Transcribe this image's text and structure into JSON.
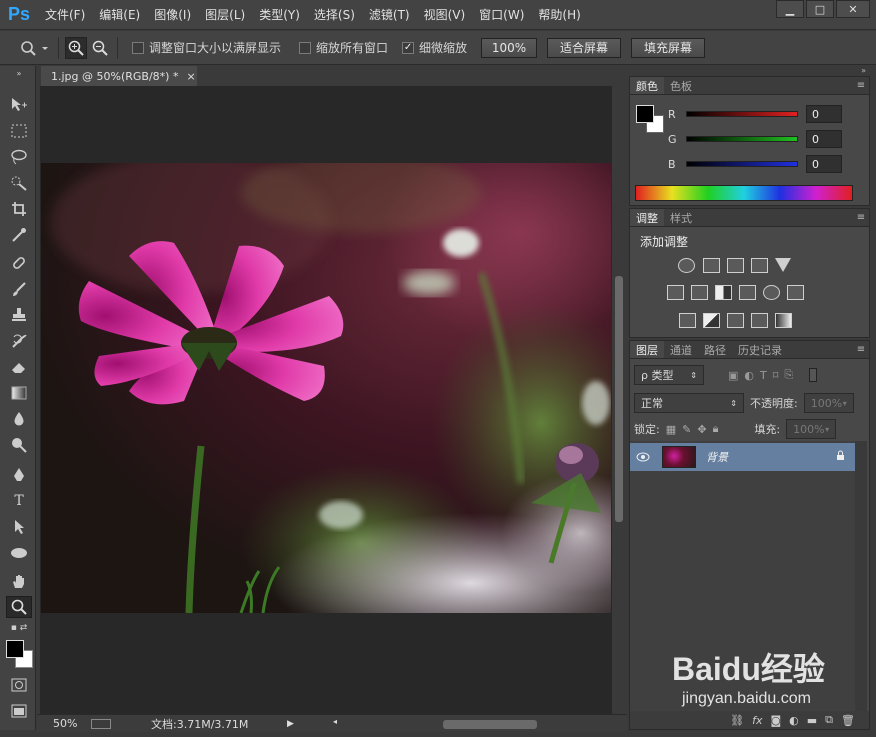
{
  "app": {
    "logo": "Ps"
  },
  "menu": [
    "文件(F)",
    "编辑(E)",
    "图像(I)",
    "图层(L)",
    "类型(Y)",
    "选择(S)",
    "滤镜(T)",
    "视图(V)",
    "窗口(W)",
    "帮助(H)"
  ],
  "window_buttons": {
    "minimize": "▁",
    "restore": "□",
    "close": "✕"
  },
  "options": {
    "resize_windows_label": "调整窗口大小以满屏显示",
    "resize_windows_checked": false,
    "zoom_all_label": "缩放所有窗口",
    "zoom_all_checked": false,
    "scrubby_label": "细微缩放",
    "scrubby_checked": true,
    "btn_100": "100%",
    "btn_fit": "适合屏幕",
    "btn_fill": "填充屏幕"
  },
  "document": {
    "tab_title": "1.jpg @ 50%(RGB/8*) *",
    "tab_close": "×",
    "zoom": "50%",
    "doc_size": "文档:3.71M/3.71M"
  },
  "color_panel": {
    "tabs": [
      "颜色",
      "色板"
    ],
    "channels": [
      {
        "label": "R",
        "value": "0",
        "color": "#e02020"
      },
      {
        "label": "G",
        "value": "0",
        "color": "#20c020"
      },
      {
        "label": "B",
        "value": "0",
        "color": "#2030e0"
      }
    ],
    "foreground": "#000000",
    "background": "#ffffff"
  },
  "adjust_panel": {
    "tabs": [
      "调整",
      "样式"
    ],
    "heading": "添加调整"
  },
  "layers_panel": {
    "tabs": [
      "图层",
      "通道",
      "路径",
      "历史记录"
    ],
    "filter_kind": "ρ 类型",
    "blend_mode": "正常",
    "opacity_label": "不透明度:",
    "opacity_value": "100%",
    "lock_label": "锁定:",
    "fill_label": "填充:",
    "fill_value": "100%",
    "layers": [
      {
        "name": "背景",
        "visible": true,
        "locked": true
      }
    ],
    "footer_icons": [
      "link-icon",
      "fx-icon",
      "mask-icon",
      "adjustment-icon",
      "folder-icon",
      "new-layer-icon",
      "trash-icon"
    ]
  },
  "watermark": {
    "logo": "Baidu经验",
    "url": "jingyan.baidu.com"
  }
}
